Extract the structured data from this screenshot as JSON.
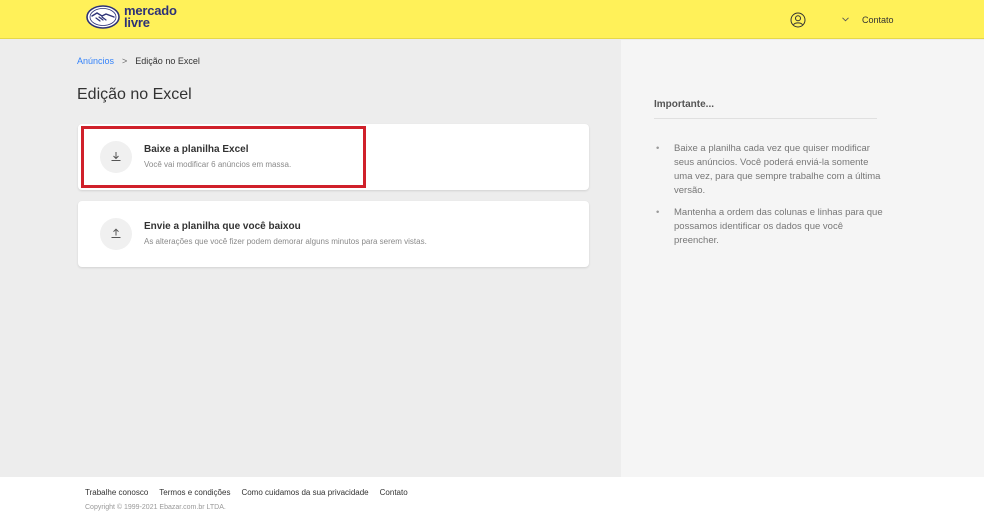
{
  "header": {
    "logo": {
      "line1": "mercado",
      "line2": "livre"
    },
    "user_icon": "user-circle-icon",
    "chevron_icon": "chevron-down-icon",
    "contact_label": "Contato"
  },
  "breadcrumb": {
    "parent": "Anúncios",
    "separator": ">",
    "current": "Edição no Excel"
  },
  "page": {
    "title": "Edição no Excel"
  },
  "cards": [
    {
      "icon": "download-icon",
      "title": "Baixe a planilha Excel",
      "description": "Você vai modificar 6 anúncios em massa."
    },
    {
      "icon": "upload-icon",
      "title": "Envie a planilha que você baixou",
      "description": "As alterações que você fizer podem demorar alguns minutos para serem vistas."
    }
  ],
  "sidebar": {
    "title": "Importante...",
    "items": [
      "Baixe a planilha cada vez que quiser modificar seus anúncios. Você poderá enviá-la somente uma vez, para que sempre trabalhe com a última versão.",
      "Mantenha a ordem das colunas e linhas para que possamos identificar os dados que você preencher."
    ]
  },
  "footer": {
    "links": [
      "Trabalhe conosco",
      "Termos e condições",
      "Como cuidamos da sua privacidade",
      "Contato"
    ],
    "copyright": "Copyright © 1999-2021 Ebazar.com.br LTDA."
  },
  "colors": {
    "header_bg": "#fff159",
    "brand_text": "#2d3277",
    "link": "#3483fa",
    "highlight": "#d0202a"
  }
}
